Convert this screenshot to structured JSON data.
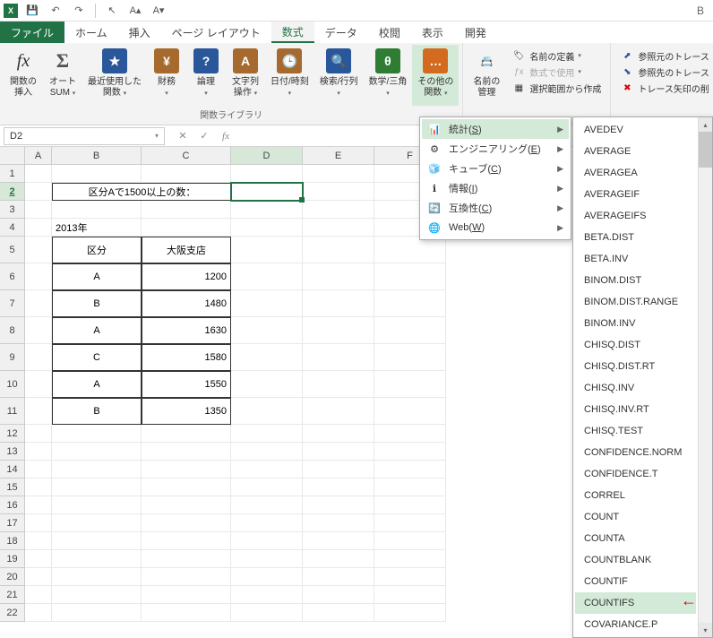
{
  "titlebar": {
    "right_label": "B"
  },
  "tabs": {
    "file": "ファイル",
    "home": "ホーム",
    "insert": "挿入",
    "pagelayout": "ページ レイアウト",
    "formulas": "数式",
    "data": "データ",
    "review": "校閲",
    "view": "表示",
    "developer": "開発"
  },
  "ribbon": {
    "insert_fn": {
      "label1": "関数の",
      "label2": "挿入"
    },
    "autosum": {
      "label1": "オート",
      "label2": "SUM"
    },
    "recent": {
      "label1": "最近使用した",
      "label2": "関数"
    },
    "financial": {
      "label": "財務"
    },
    "logical": {
      "label": "論理"
    },
    "text": {
      "label1": "文字列",
      "label2": "操作"
    },
    "datetime": {
      "label": "日付/時刻"
    },
    "lookup": {
      "label": "検索/行列"
    },
    "math": {
      "label": "数学/三角"
    },
    "more": {
      "label1": "その他の",
      "label2": "関数"
    },
    "name_mgr": {
      "label1": "名前の",
      "label2": "管理"
    },
    "def_name": "名前の定義",
    "use_in_formula": "数式で使用",
    "create_from_sel": "選択範囲から作成",
    "trace_prec": "参照元のトレース",
    "trace_dep": "参照先のトレース",
    "remove_arrows": "トレース矢印の削",
    "group_label": "関数ライブラリ"
  },
  "namebox": "D2",
  "columns": [
    "A",
    "B",
    "C",
    "D",
    "E",
    "F"
  ],
  "rows": [
    "1",
    "2",
    "3",
    "4",
    "5",
    "6",
    "7",
    "8",
    "9",
    "10",
    "11",
    "12",
    "13",
    "14",
    "15",
    "16",
    "17",
    "18",
    "19",
    "20",
    "21",
    "22"
  ],
  "cells": {
    "B2": "区分Aで1500以上の数：",
    "B4": "2013年",
    "B5": "区分",
    "C5": "大阪支店",
    "B6": "A",
    "C6": "1200",
    "B7": "B",
    "C7": "1480",
    "B8": "A",
    "C8": "1630",
    "B9": "C",
    "C9": "1580",
    "B10": "A",
    "C10": "1550",
    "B11": "B",
    "C11": "1350"
  },
  "menu1": {
    "statistics": "統計",
    "statistics_key": "S",
    "engineering": "エンジニアリング",
    "engineering_key": "E",
    "cube": "キューブ",
    "cube_key": "C",
    "info": "情報",
    "info_key": "I",
    "compat": "互換性",
    "compat_key": "C",
    "web": "Web",
    "web_key": "W"
  },
  "menu2": [
    "AVEDEV",
    "AVERAGE",
    "AVERAGEA",
    "AVERAGEIF",
    "AVERAGEIFS",
    "BETA.DIST",
    "BETA.INV",
    "BINOM.DIST",
    "BINOM.DIST.RANGE",
    "BINOM.INV",
    "CHISQ.DIST",
    "CHISQ.DIST.RT",
    "CHISQ.INV",
    "CHISQ.INV.RT",
    "CHISQ.TEST",
    "CONFIDENCE.NORM",
    "CONFIDENCE.T",
    "CORREL",
    "COUNT",
    "COUNTA",
    "COUNTBLANK",
    "COUNTIF",
    "COUNTIFS",
    "COVARIANCE.P"
  ]
}
